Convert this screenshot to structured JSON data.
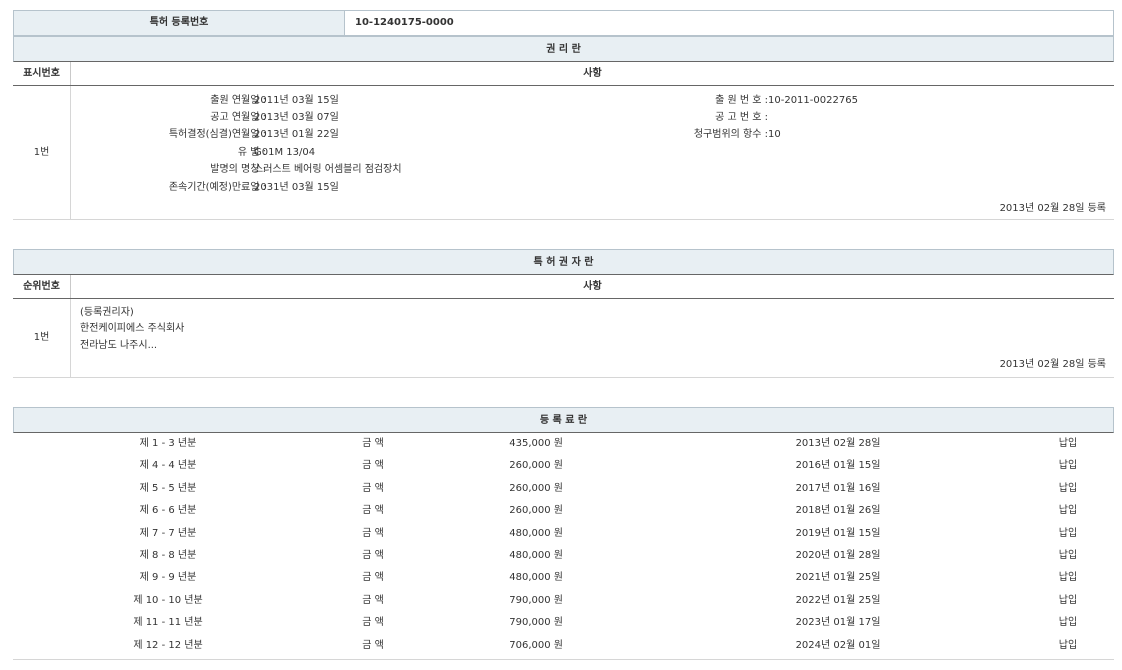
{
  "registration": {
    "label": "특허 등록번호",
    "number": "10-1240175-0000"
  },
  "rights_section": {
    "title": "권 리 란",
    "col_num": "표시번호",
    "col_detail": "사항",
    "row_num": "1번",
    "left_fields": [
      {
        "key": "출원 연월일 :",
        "value": "2011년 03월 15일"
      },
      {
        "key": "공고 연월일 :",
        "value": "2013년 03월 07일"
      },
      {
        "key": "특허결정(심결)연월일 :",
        "value": "2013년 01월 22일"
      },
      {
        "key": "유 별 :",
        "value": "G01M 13/04"
      },
      {
        "key": "발명의 명칭 :",
        "value": "스러스트 베어링 어셈블리 점검장치"
      },
      {
        "key": "존속기간(예정)만료일 :",
        "value": "2031년 03월 15일"
      }
    ],
    "right_fields": [
      {
        "key": "출 원 번 호 :",
        "value": "10-2011-0022765"
      },
      {
        "key": "공 고 번 호 :",
        "value": ""
      },
      {
        "key": "청구범위의 항수 :",
        "value": "10"
      }
    ],
    "reg_date": "2013년 02월 28일 등록"
  },
  "holder_section": {
    "title": "특 허 권 자 란",
    "col_num": "순위번호",
    "col_detail": "사항",
    "row_num": "1번",
    "lines": [
      "(등록권리자)",
      "한전케이피에스 주식회사",
      "전라남도 나주시..."
    ],
    "reg_date": "2013년 02월 28일 등록"
  },
  "fee_section": {
    "title": "등 록 료 란",
    "rows": [
      {
        "period": "제 1 - 3 년분",
        "label": "금 액",
        "amount": "435,000 원",
        "date": "2013년 02월 28일",
        "status": "납입"
      },
      {
        "period": "제 4 - 4 년분",
        "label": "금 액",
        "amount": "260,000 원",
        "date": "2016년 01월 15일",
        "status": "납입"
      },
      {
        "period": "제 5 - 5 년분",
        "label": "금 액",
        "amount": "260,000 원",
        "date": "2017년 01월 16일",
        "status": "납입"
      },
      {
        "period": "제 6 - 6 년분",
        "label": "금 액",
        "amount": "260,000 원",
        "date": "2018년 01월 26일",
        "status": "납입"
      },
      {
        "period": "제 7 - 7 년분",
        "label": "금 액",
        "amount": "480,000 원",
        "date": "2019년 01월 15일",
        "status": "납입"
      },
      {
        "period": "제 8 - 8 년분",
        "label": "금 액",
        "amount": "480,000 원",
        "date": "2020년 01월 28일",
        "status": "납입"
      },
      {
        "period": "제 9 - 9 년분",
        "label": "금 액",
        "amount": "480,000 원",
        "date": "2021년 01월 25일",
        "status": "납입"
      },
      {
        "period": "제 10 - 10 년분",
        "label": "금 액",
        "amount": "790,000 원",
        "date": "2022년 01월 25일",
        "status": "납입"
      },
      {
        "period": "제 11 - 11 년분",
        "label": "금 액",
        "amount": "790,000 원",
        "date": "2023년 01월 17일",
        "status": "납입"
      },
      {
        "period": "제 12 - 12 년분",
        "label": "금 액",
        "amount": "706,000 원",
        "date": "2024년 02월 01일",
        "status": "납입"
      }
    ]
  }
}
